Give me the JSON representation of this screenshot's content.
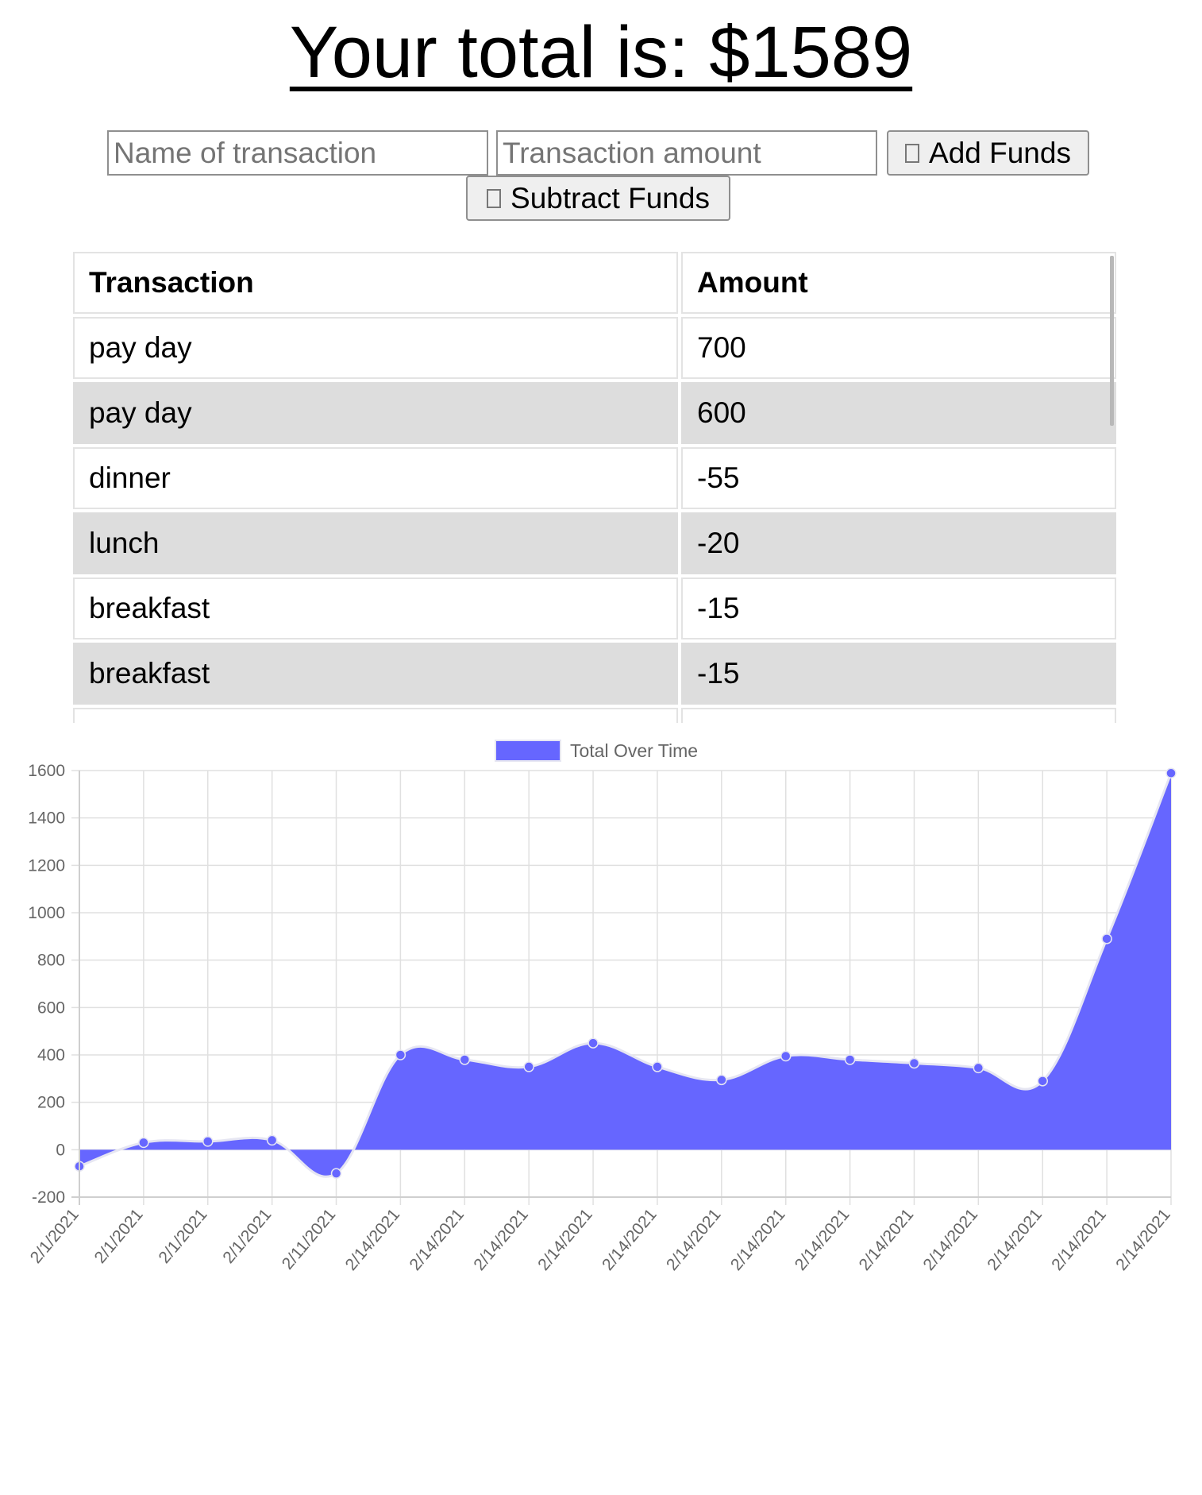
{
  "header": {
    "total_text": "Your total is: $1589"
  },
  "form": {
    "name_placeholder": "Name of transaction",
    "name_value": "",
    "amount_placeholder": "Transaction amount",
    "amount_value": "",
    "add_label": "Add Funds",
    "subtract_label": "Subtract Funds"
  },
  "table": {
    "headers": [
      "Transaction",
      "Amount"
    ],
    "rows": [
      {
        "name": "pay day",
        "amount": "700"
      },
      {
        "name": "pay day",
        "amount": "600"
      },
      {
        "name": "dinner",
        "amount": "-55"
      },
      {
        "name": "lunch",
        "amount": "-20"
      },
      {
        "name": "breakfast",
        "amount": "-15"
      },
      {
        "name": "breakfast",
        "amount": "-15"
      }
    ]
  },
  "colors": {
    "series_fill": "#6666ff",
    "series_point": "#6666ff",
    "grid": "#e0e0e0",
    "even_row": "#dddddd"
  },
  "chart_data": {
    "type": "area",
    "title": "",
    "xlabel": "",
    "ylabel": "",
    "legend": "top-center",
    "grid": true,
    "ylim": [
      -200,
      1600
    ],
    "yticks": [
      1600,
      1400,
      1200,
      1000,
      800,
      600,
      400,
      200,
      0,
      -200
    ],
    "x": [
      "2/1/2021",
      "2/1/2021",
      "2/1/2021",
      "2/1/2021",
      "2/11/2021",
      "2/14/2021",
      "2/14/2021",
      "2/14/2021",
      "2/14/2021",
      "2/14/2021",
      "2/14/2021",
      "2/14/2021",
      "2/14/2021",
      "2/14/2021",
      "2/14/2021",
      "2/14/2021",
      "2/14/2021",
      "2/14/2021"
    ],
    "series": [
      {
        "name": "Total Over Time",
        "values": [
          -70,
          30,
          35,
          40,
          -100,
          400,
          380,
          350,
          450,
          350,
          295,
          395,
          380,
          365,
          345,
          290,
          890,
          1589
        ]
      }
    ]
  }
}
